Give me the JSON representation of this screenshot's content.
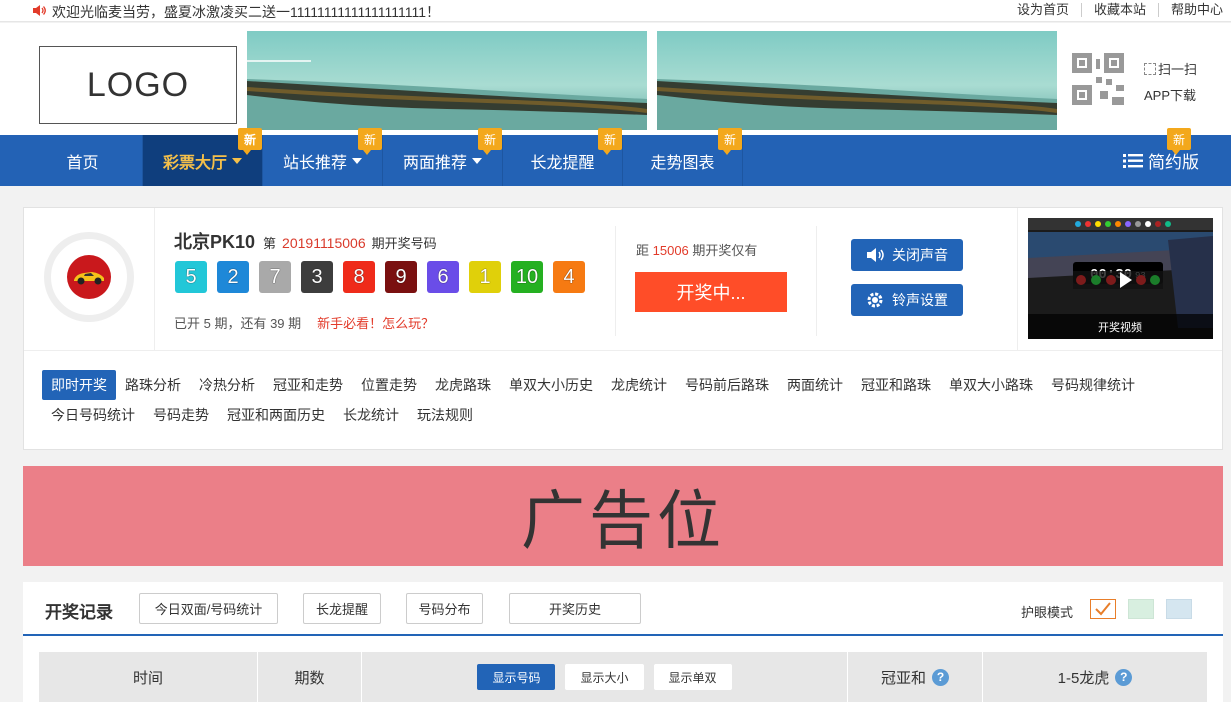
{
  "topbar": {
    "notice": "欢迎光临麦当劳，盛夏冰激凌买二送一11111111111111111111！",
    "links": [
      "设为首页",
      "收藏本站",
      "帮助中心"
    ]
  },
  "header": {
    "logo": "LOGO",
    "scan_label": "扫一扫",
    "app_label": "APP下载"
  },
  "nav": {
    "items": [
      {
        "label": "首页",
        "badge": ""
      },
      {
        "label": "彩票大厅",
        "badge": "新"
      },
      {
        "label": "站长推荐",
        "badge": "新"
      },
      {
        "label": "两面推荐",
        "badge": "新"
      },
      {
        "label": "长龙提醒",
        "badge": "新"
      },
      {
        "label": "走势图表",
        "badge": "新"
      }
    ],
    "simple": {
      "label": "简约版",
      "badge": "新"
    },
    "active_color": "#f5c04a",
    "bg_color": "#2362b5"
  },
  "lottery": {
    "name": "北京PK10",
    "di": "第",
    "issue": "20191115006",
    "issue_suffix": "期开奖号码",
    "balls": [
      {
        "num": "5",
        "color": "#22c7d8"
      },
      {
        "num": "2",
        "color": "#1e88d8"
      },
      {
        "num": "7",
        "color": "#a9a9a9"
      },
      {
        "num": "3",
        "color": "#3d3d3d"
      },
      {
        "num": "8",
        "color": "#ef2b1a"
      },
      {
        "num": "9",
        "color": "#7a1010"
      },
      {
        "num": "6",
        "color": "#6a4de8"
      },
      {
        "num": "1",
        "color": "#e0d00a"
      },
      {
        "num": "10",
        "color": "#25b021"
      },
      {
        "num": "4",
        "color": "#f67a12"
      }
    ],
    "progress": "已开 5 期，还有 39 期",
    "help": "新手必看！怎么玩？",
    "countdown_prefix": "距",
    "countdown_issue": "15006",
    "countdown_suffix": "期开奖仅有",
    "drawing_label": "开奖中...",
    "mute_label": "关闭声音",
    "ring_label": "铃声设置",
    "video_label": "开奖视频",
    "video_timer": "00:30",
    "video_timer_ms": "93"
  },
  "tabs": [
    "即时开奖",
    "路珠分析",
    "冷热分析",
    "冠亚和走势",
    "位置走势",
    "龙虎路珠",
    "单双大小历史",
    "龙虎统计",
    "号码前后路珠",
    "两面统计",
    "冠亚和路珠",
    "单双大小路珠",
    "号码规律统计",
    "今日号码统计",
    "号码走势",
    "冠亚和两面历史",
    "长龙统计",
    "玩法规则"
  ],
  "ad": {
    "text": "广告位",
    "color": "#eb7f88"
  },
  "record": {
    "title": "开奖记录",
    "buttons": [
      "今日双面/号码统计",
      "长龙提醒",
      "号码分布",
      "开奖历史"
    ],
    "eye_mode": "护眼模式",
    "columns": {
      "time": "时间",
      "issue": "期数",
      "pills": [
        "显示号码",
        "显示大小",
        "显示单双"
      ],
      "sum": "冠亚和",
      "dragon": "1-5龙虎",
      "q": "?"
    }
  }
}
